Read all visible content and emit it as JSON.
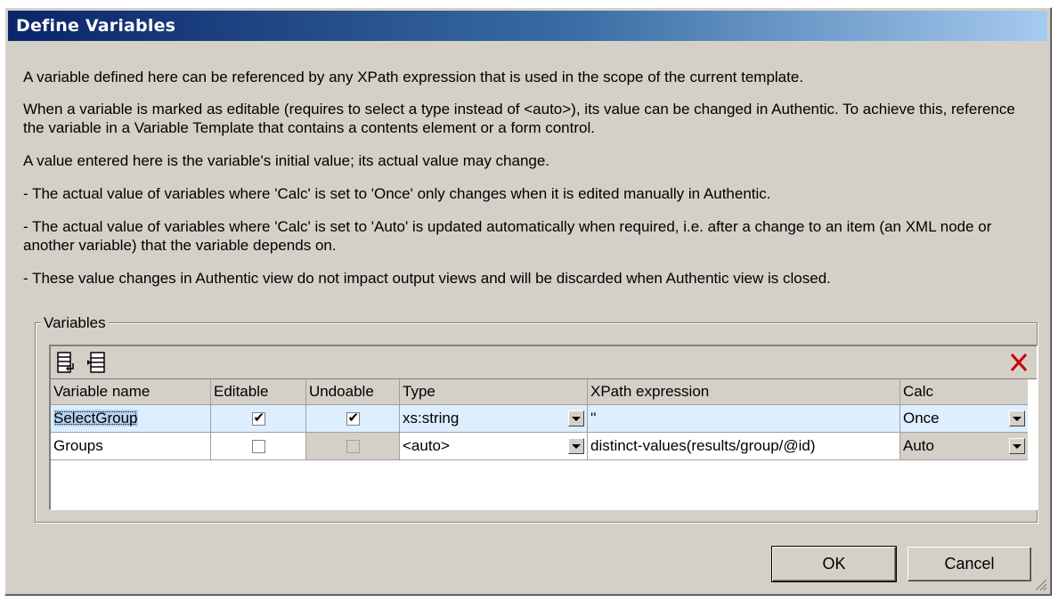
{
  "dialog": {
    "title": "Define Variables",
    "descriptions": [
      "A variable defined here can be referenced by any XPath expression that is used in the scope of the current template.",
      "When a variable is marked as editable (requires to select a type instead of <auto>), its value can be changed in Authentic. To achieve this, reference the variable in a Variable Template that contains a contents element or a form control.",
      "A value entered here is the variable's initial value; its actual value may change.",
      "- The actual value of variables where 'Calc' is set to 'Once' only changes when it is edited manually in Authentic.",
      "- The actual value of variables where 'Calc' is set to 'Auto' is updated automatically when required, i.e. after a change to an item (an XML node or another variable) that the variable depends on.",
      "- These value changes in Authentic view do not impact output views and will be discarded when Authentic view is closed."
    ]
  },
  "variables": {
    "group_label": "Variables",
    "columns": [
      "Variable name",
      "Editable",
      "Undoable",
      "Type",
      "XPath expression",
      "Calc"
    ],
    "rows": [
      {
        "name": "SelectGroup",
        "editable": true,
        "undoable": true,
        "type": "xs:string",
        "xpath": "''",
        "calc": "Once"
      },
      {
        "name": "Groups",
        "editable": false,
        "undoable": false,
        "type": "<auto>",
        "xpath": "distinct-values(results/group/@id)",
        "calc": "Auto"
      }
    ]
  },
  "buttons": {
    "ok": "OK",
    "cancel": "Cancel"
  },
  "icons": {
    "append": "append-variable-icon",
    "insert": "insert-variable-icon",
    "delete": "delete-variable-icon"
  },
  "colors": {
    "title_start": "#0a246a",
    "title_end": "#a6caf0",
    "delete": "#cc0000"
  }
}
